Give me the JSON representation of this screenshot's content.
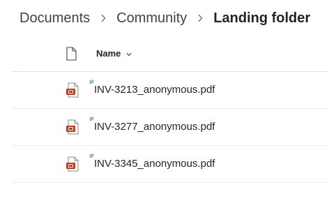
{
  "breadcrumb": {
    "items": [
      "Documents",
      "Community"
    ],
    "current": "Landing folder"
  },
  "header": {
    "name_label": "Name",
    "file_type_icon": "document-icon",
    "sort_icon": "chevron-down-icon"
  },
  "files": [
    {
      "name": "INV-3213_anonymous.pdf",
      "icon": "pdf-icon",
      "status_icon": "new-file-sparkle-icon"
    },
    {
      "name": "INV-3277_anonymous.pdf",
      "icon": "pdf-icon",
      "status_icon": "new-file-sparkle-icon"
    },
    {
      "name": "INV-3345_anonymous.pdf",
      "icon": "pdf-icon",
      "status_icon": "new-file-sparkle-icon"
    }
  ],
  "colors": {
    "pdf_red": "#c43e1c",
    "new_blue": "#0f6cbd",
    "divider": "#e1e1e1"
  }
}
